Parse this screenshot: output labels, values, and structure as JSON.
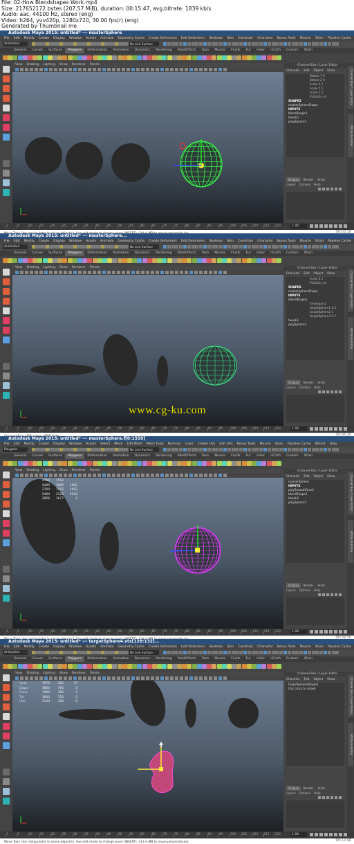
{
  "file_info": {
    "line1": "File: 02-How Blendshapes Work.mp4",
    "line2": "Size: 217652172 bytes (207.57 MiB), duration: 00:15:47, avg.bitrate: 1839 kb/s",
    "line3": "Audio: aac, 44100 Hz, stereo (eng)",
    "line4": "Video: h264, yuv420p, 1280x720, 30.00 fps(r) (eng)",
    "line5": "Generated by Thumbnail me"
  },
  "watermark": "www.cg-ku.com",
  "menu": [
    "File",
    "Edit",
    "Modify",
    "Create",
    "Display",
    "Window",
    "Assets",
    "Animate",
    "Geometry Cache",
    "Create Deformers",
    "Edit Deformers",
    "Skeleton",
    "Skin",
    "Constrain",
    "Character",
    "Bonus Tools",
    "Muscle",
    "XGen",
    "Pipeline Cache",
    "Bifrost",
    "Help"
  ],
  "menu_f3": [
    "File",
    "Edit",
    "Modify",
    "Create",
    "Display",
    "Window",
    "Assets",
    "Select",
    "Mesh",
    "Edit Mesh",
    "Mesh Tools",
    "Normals",
    "Color",
    "Create UVs",
    "Edit UVs",
    "Bonus Tools",
    "Muscle",
    "XGen",
    "Pipeline Cache",
    "Bifrost",
    "Help"
  ],
  "shelf_tabs": [
    "General",
    "Curves",
    "Surfaces",
    "Polygons",
    "Deformation",
    "Animation",
    "Dynamics",
    "Rendering",
    "PaintEffects",
    "Toon",
    "Muscle",
    "Fluids",
    "Fur",
    "nHair",
    "nCloth",
    "Custom",
    "XGen"
  ],
  "active_shelf_tab": "Polygons",
  "viewport_menu": [
    "View",
    "Shading",
    "Lighting",
    "Show",
    "Renderer",
    "Panels"
  ],
  "channel_box": {
    "title": "Channel Box / Layer Editor",
    "menu": [
      "Channels",
      "Edit",
      "Object",
      "Show"
    ],
    "layer_tabs": [
      "Display",
      "Render",
      "Anim"
    ],
    "layer_menu": [
      "Layers",
      "Options",
      "Help"
    ]
  },
  "side_tabs": [
    "Channel Box / Layer Editor",
    "Attribute Editor"
  ],
  "common": {
    "mode": "Animation",
    "mode_f3": "Polygons",
    "no_live_surface": "No Live Surface",
    "start_frame": "1.00",
    "end_frame": "120",
    "range_start": "1.00",
    "range_start2": "1.00",
    "range_end": "120.00",
    "range_end2": "200.00",
    "anim_layer": "No Anim Layer",
    "character_set": "No Character Set",
    "mel": "MEL",
    "current_frame": "1.00",
    "slider_value": "120",
    "time_ticks": [
      "1",
      "5",
      "10",
      "15",
      "20",
      "25",
      "30",
      "35",
      "40",
      "45",
      "50",
      "55",
      "60",
      "65",
      "70",
      "75",
      "80",
      "85",
      "90",
      "95",
      "100",
      "105",
      "110",
      "115",
      "120"
    ]
  },
  "frames": [
    {
      "title": "Autodesk Maya 2015: untitled*  ---  masterSphere",
      "timestamp": "00:03:10",
      "help": "Move Tool: Use manipulator to move object(s). Use edit mode to change pivot (INSERT).  Ctrl+LMB to move perpendicular.",
      "channels": [
        {
          "t": "attr",
          "text": "Rotate Y 0"
        },
        {
          "t": "attr",
          "text": "Rotate Z 0"
        },
        {
          "t": "attr",
          "text": "Scale X 1"
        },
        {
          "t": "attr",
          "text": "Scale Y 1"
        },
        {
          "t": "attr",
          "text": "Scale Z 1"
        },
        {
          "t": "attr",
          "text": "Visibility on"
        },
        {
          "t": "head",
          "text": "SHAPES"
        },
        {
          "t": "row",
          "text": "masterSphereShape"
        },
        {
          "t": "head",
          "text": "INPUTS"
        },
        {
          "t": "row",
          "text": "blendShape1"
        },
        {
          "t": "row",
          "text": "tweak1"
        },
        {
          "t": "row",
          "text": "polySphere1"
        }
      ]
    },
    {
      "title": "Autodesk Maya 2015: untitled*  ---  masterSphere...",
      "timestamp": "00:06:20",
      "help": "Channel Box: LMB select, MMB slide",
      "channels": [
        {
          "t": "attr",
          "text": "Scale Z 1"
        },
        {
          "t": "attr",
          "text": "Visibility on"
        },
        {
          "t": "head",
          "text": "SHAPES"
        },
        {
          "t": "row",
          "text": "masterSphereShape"
        },
        {
          "t": "head",
          "text": "INPUTS"
        },
        {
          "t": "row",
          "text": "blendShape1"
        },
        {
          "t": "attr",
          "text": "Envelope 1"
        },
        {
          "t": "attr",
          "text": "targetSphere1 0.3"
        },
        {
          "t": "attr",
          "text": "targetSphere2 1"
        },
        {
          "t": "attr",
          "text": "targetSphere3 0.7"
        },
        {
          "t": "row",
          "text": "tweak1"
        },
        {
          "t": "row",
          "text": "polySphere1"
        }
      ]
    },
    {
      "title": "Autodesk Maya 2015: untitled*  ---  masterSphere.f[0:1559]",
      "timestamp": "00:09:30",
      "help": "Move Tool: Use manipulator to move object(s). Use edit mode to change pivot (INSERT).  Ctrl+LMB to move perpendicular.",
      "hud": [
        [
          "",
          "2760",
          "1542",
          ""
        ],
        [
          "",
          "5400",
          "3089",
          "1982"
        ],
        [
          "",
          "2760",
          "1542",
          "1982"
        ],
        [
          "",
          "5400",
          "3120",
          "2520"
        ],
        [
          "",
          "2856",
          "1677",
          "0"
        ]
      ],
      "channels": [
        {
          "t": "row",
          "text": "masterSphere"
        },
        {
          "t": "head",
          "text": "INPUTS"
        },
        {
          "t": "row",
          "text": "polySmoothFace1"
        },
        {
          "t": "row",
          "text": "blendShape1"
        },
        {
          "t": "row",
          "text": "tweak1"
        },
        {
          "t": "row",
          "text": "polySphere1"
        }
      ]
    },
    {
      "title": "Autodesk Maya 2015: untitled*  ---  targetSphere4.vtx[128:132]...",
      "timestamp": "00:12:40",
      "help": "Move Tool: Use manipulator to move object(s). Use edit mode to change pivot (INSERT).  Ctrl+LMB to move perpendicular.",
      "hud": [
        [
          "Verts",
          "1978",
          "382",
          "47"
        ],
        [
          "Edges",
          "3800",
          "760",
          "0"
        ],
        [
          "Faces",
          "1900",
          "380",
          "0"
        ],
        [
          "Tris",
          "3600",
          "720",
          "0"
        ],
        [
          "UVs",
          "2140",
          "428",
          "0"
        ]
      ],
      "channels": [
        {
          "t": "row",
          "text": "targetSphereShape4"
        },
        {
          "t": "row",
          "text": "CVs (click to show)"
        }
      ]
    }
  ]
}
